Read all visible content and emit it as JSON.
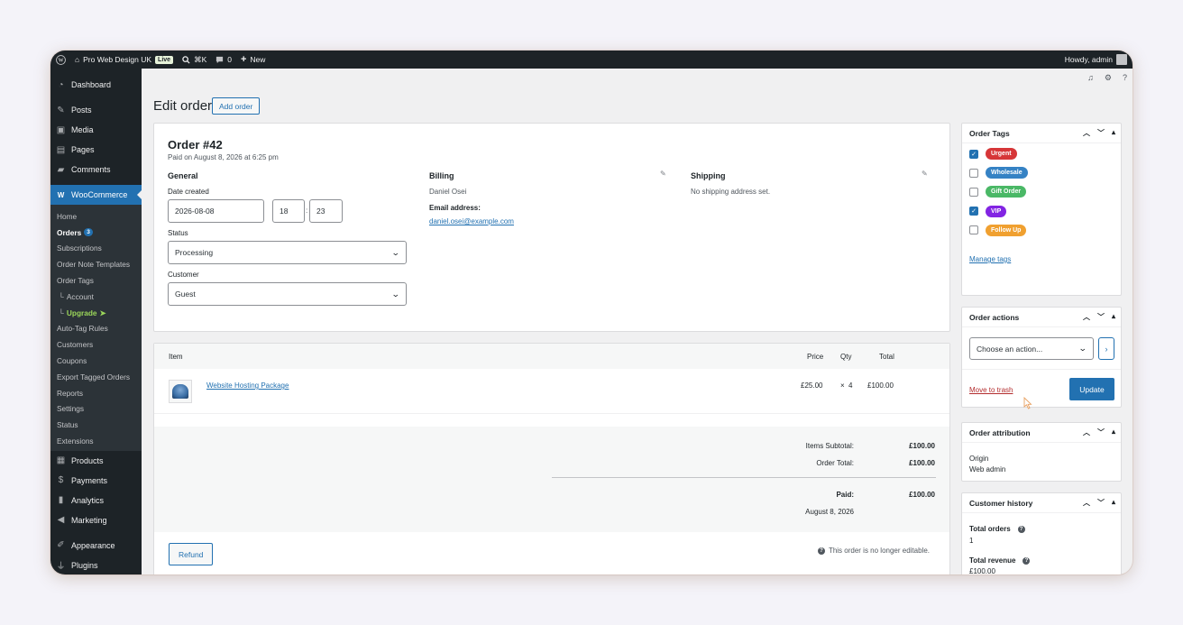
{
  "adminbar": {
    "site_name": "Pro Web Design UK",
    "live_badge": "Live",
    "shortcut": "⌘K",
    "comments_count": "0",
    "new_label": "New",
    "howdy": "Howdy, admin"
  },
  "sidebar": {
    "dashboard": "Dashboard",
    "posts": "Posts",
    "media": "Media",
    "pages": "Pages",
    "comments": "Comments",
    "woocommerce": "WooCommerce",
    "sub": {
      "home": "Home",
      "orders": "Orders",
      "orders_count": "3",
      "subscriptions": "Subscriptions",
      "order_note_templates": "Order Note Templates",
      "order_tags": "Order Tags",
      "account": "Account",
      "upgrade": "Upgrade",
      "auto_tag_rules": "Auto-Tag Rules",
      "customers": "Customers",
      "coupons": "Coupons",
      "export_tagged_orders": "Export Tagged Orders",
      "reports": "Reports",
      "settings": "Settings",
      "status": "Status",
      "extensions": "Extensions"
    },
    "products": "Products",
    "payments": "Payments",
    "analytics": "Analytics",
    "marketing": "Marketing",
    "appearance": "Appearance",
    "plugins": "Plugins"
  },
  "page": {
    "title": "Edit order",
    "add_order": "Add order"
  },
  "order": {
    "title": "Order #42",
    "paid_on": "Paid on August 8, 2026 at 6:25 pm",
    "general": {
      "heading": "General",
      "date_label": "Date created",
      "date": "2026-08-08",
      "hour": "18",
      "minute": "23",
      "status_label": "Status",
      "status": "Processing",
      "customer_label": "Customer",
      "customer": "Guest"
    },
    "billing": {
      "heading": "Billing",
      "name": "Daniel Osei",
      "email_label": "Email address:",
      "email": "daniel.osei@example.com"
    },
    "shipping": {
      "heading": "Shipping",
      "text": "No shipping address set."
    }
  },
  "items": {
    "headers": {
      "item": "Item",
      "price": "Price",
      "qty": "Qty",
      "total": "Total"
    },
    "rows": [
      {
        "name": "Website Hosting Package",
        "price": "£25.00",
        "qty_sym": "×",
        "qty": "4",
        "total": "£100.00"
      }
    ],
    "subtotal_label": "Items Subtotal:",
    "subtotal": "£100.00",
    "order_total_label": "Order Total:",
    "order_total": "£100.00",
    "paid_label": "Paid:",
    "paid": "£100.00",
    "paid_date": "August 8, 2026",
    "refund": "Refund",
    "note": "This order is no longer editable."
  },
  "order_tags": {
    "heading": "Order Tags",
    "tags": [
      {
        "label": "Urgent",
        "checked": true,
        "color": "#d63638"
      },
      {
        "label": "Wholesale",
        "checked": false,
        "color": "#3582c4"
      },
      {
        "label": "Gift Order",
        "checked": false,
        "color": "#4ab866"
      },
      {
        "label": "VIP",
        "checked": true,
        "color": "#8224e3"
      },
      {
        "label": "Follow Up",
        "checked": false,
        "color": "#f0a030"
      }
    ],
    "manage": "Manage tags"
  },
  "order_actions": {
    "heading": "Order actions",
    "select": "Choose an action...",
    "trash": "Move to trash",
    "update": "Update"
  },
  "attribution": {
    "heading": "Order attribution",
    "origin_label": "Origin",
    "origin": "Web admin"
  },
  "customer_history": {
    "heading": "Customer history",
    "total_orders_label": "Total orders",
    "total_orders": "1",
    "total_revenue_label": "Total revenue",
    "total_revenue": "£100.00"
  }
}
